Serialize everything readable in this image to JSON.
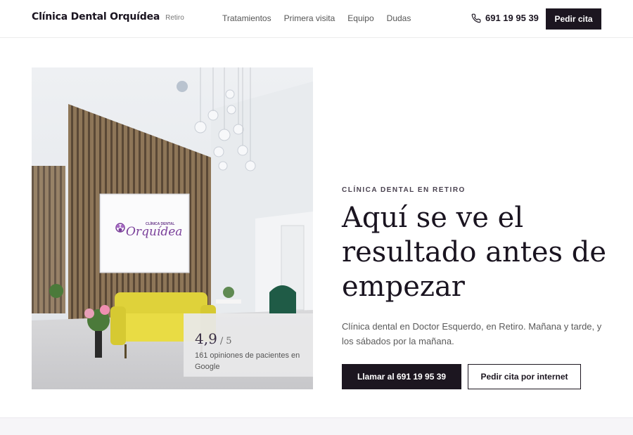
{
  "header": {
    "brand_name": "Clínica Dental Orquídea",
    "brand_location": "Retiro",
    "nav": [
      "Tratamientos",
      "Primera visita",
      "Equipo",
      "Dudas"
    ],
    "phone": "691 19 95 39",
    "cta_label": "Pedir cita"
  },
  "hero": {
    "eyebrow": "CLÍNICA DENTAL EN RETIRO",
    "title": "Aquí se ve el resultado antes de empezar",
    "description": "Clínica dental en Doctor Esquerdo, en Retiro. Mañana y tarde, y los sábados por la mañana.",
    "primary_button": "Llamar al 691 19 95 39",
    "secondary_button": "Pedir cita por internet",
    "photo": {
      "sign_small": "CLÍNICA DENTAL",
      "sign_logo": "Orquídea"
    },
    "rating": {
      "score": "4,9",
      "separator": "/",
      "max": "5",
      "reviews_text": "161 opiniones de pacientes en Google"
    }
  },
  "colors": {
    "dark": "#1c1620",
    "accent_purple": "#7a3f9a",
    "sofa_yellow": "#e6d93a"
  }
}
